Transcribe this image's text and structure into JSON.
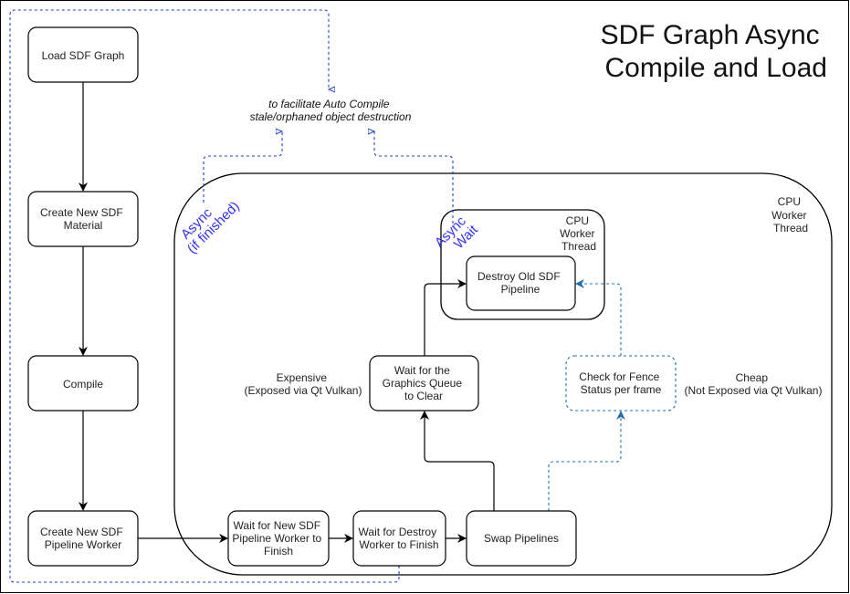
{
  "title": [
    "SDF Graph Async",
    "Compile and Load"
  ],
  "note": [
    "to facilitate Auto Compile",
    "stale/orphaned object destruction"
  ],
  "containers": {
    "outer_thread": [
      "CPU",
      "Worker",
      "Thread"
    ],
    "inner_thread": [
      "CPU",
      "Worker",
      "Thread"
    ]
  },
  "nodes": {
    "load_graph": [
      "Load SDF Graph"
    ],
    "create_material": [
      "Create New SDF",
      "Material"
    ],
    "compile": [
      "Compile"
    ],
    "create_pipeline_worker": [
      "Create New SDF",
      "Pipeline Worker"
    ],
    "wait_new_worker": [
      "Wait for New SDF",
      "Pipeline Worker to",
      "Finish"
    ],
    "wait_destroy_worker": [
      "Wait for Destroy",
      "Worker to Finish"
    ],
    "swap_pipelines": [
      "Swap Pipelines"
    ],
    "wait_graphics_queue": [
      "Wait for the",
      "Graphics Queue",
      "to Clear"
    ],
    "check_fence": [
      "Check for Fence",
      "Status per frame"
    ],
    "destroy_old_pipeline": [
      "Destroy Old SDF",
      "Pipeline"
    ]
  },
  "labels": {
    "expensive": [
      "Expensive",
      "(Exposed via Qt Vulkan)"
    ],
    "cheap": [
      "Cheap",
      "(Not Exposed via Qt Vulkan)"
    ],
    "async_if_finished": [
      "Async",
      "(if finished)"
    ],
    "async_wait": [
      "Async",
      "Wait"
    ]
  },
  "colors": {
    "stroke": "#000000",
    "async_blue": "#1f3fcc",
    "fence_blue": "#1f6fb0",
    "label_blue": "#3333ff"
  }
}
